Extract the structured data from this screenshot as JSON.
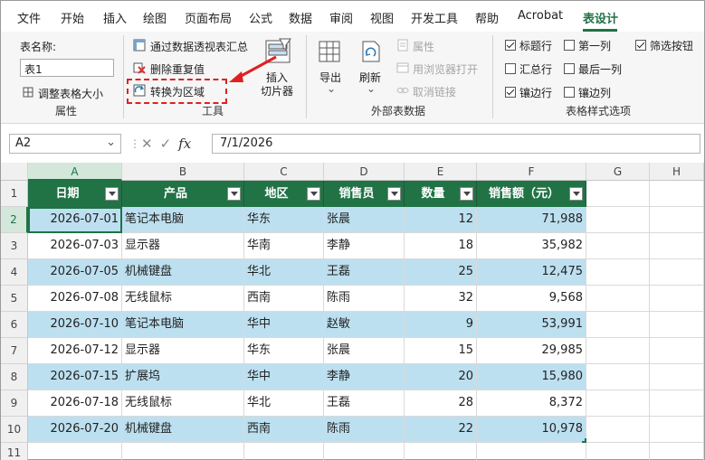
{
  "menu": [
    "文件",
    "开始",
    "插入",
    "绘图",
    "页面布局",
    "公式",
    "数据",
    "审阅",
    "视图",
    "开发工具",
    "帮助",
    "Acrobat",
    "表设计"
  ],
  "ribbon": {
    "properties": {
      "table_name_label": "表名称:",
      "table_name": "表1",
      "resize": "调整表格大小",
      "group": "属性"
    },
    "tools": {
      "pivot": "通过数据透视表汇总",
      "remove_dup": "删除重复值",
      "convert": "转换为区域",
      "slicer_line1": "插入",
      "slicer_line2": "切片器",
      "group": "工具"
    },
    "external": {
      "export": "导出",
      "refresh": "刷新",
      "props": "属性",
      "open_browser": "用浏览器打开",
      "unlink": "取消链接",
      "group": "外部表数据"
    },
    "style_options": {
      "items": [
        {
          "label": "标题行",
          "checked": true
        },
        {
          "label": "第一列",
          "checked": false
        },
        {
          "label": "筛选按钮",
          "checked": true
        },
        {
          "label": "汇总行",
          "checked": false
        },
        {
          "label": "最后一列",
          "checked": false
        },
        {
          "label": "镶边行",
          "checked": true
        },
        {
          "label": "镶边列",
          "checked": false
        }
      ],
      "group": "表格样式选项"
    }
  },
  "formula_bar": {
    "name_box": "A2",
    "formula": "7/1/2026"
  },
  "columns": [
    "A",
    "B",
    "C",
    "D",
    "E",
    "F",
    "G",
    "H"
  ],
  "rows": [
    "1",
    "2",
    "3",
    "4",
    "5",
    "6",
    "7",
    "8",
    "9",
    "10",
    "11"
  ],
  "table": {
    "headers": [
      "日期",
      "产品",
      "地区",
      "销售员",
      "数量",
      "销售额（元）"
    ],
    "data": [
      [
        "2026-07-01",
        "笔记本电脑",
        "华东",
        "张晨",
        "12",
        "71,988"
      ],
      [
        "2026-07-03",
        "显示器",
        "华南",
        "李静",
        "18",
        "35,982"
      ],
      [
        "2026-07-05",
        "机械键盘",
        "华北",
        "王磊",
        "25",
        "12,475"
      ],
      [
        "2026-07-08",
        "无线鼠标",
        "西南",
        "陈雨",
        "32",
        "9,568"
      ],
      [
        "2026-07-10",
        "笔记本电脑",
        "华中",
        "赵敏",
        "9",
        "53,991"
      ],
      [
        "2026-07-12",
        "显示器",
        "华东",
        "张晨",
        "15",
        "29,985"
      ],
      [
        "2026-07-15",
        "扩展坞",
        "华中",
        "李静",
        "20",
        "15,980"
      ],
      [
        "2026-07-18",
        "无线鼠标",
        "华北",
        "王磊",
        "28",
        "8,372"
      ],
      [
        "2026-07-20",
        "机械键盘",
        "西南",
        "陈雨",
        "22",
        "10,978"
      ]
    ]
  },
  "colors": {
    "accent": "#1f7245",
    "header_fill": "#217346",
    "band_fill": "#bde0f0",
    "annotation": "#e02020"
  }
}
